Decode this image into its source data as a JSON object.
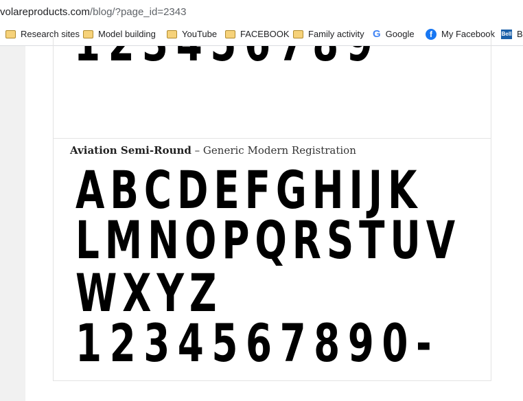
{
  "address_bar": {
    "domain": "volareproducts.com",
    "path": "/blog/?page_id=2343"
  },
  "bookmarks": [
    {
      "label": "Research sites",
      "icon": "folder-icon"
    },
    {
      "label": "Model building",
      "icon": "folder-icon"
    },
    {
      "label": "YouTube",
      "icon": "folder-icon"
    },
    {
      "label": "FACEBOOK",
      "icon": "folder-icon"
    },
    {
      "label": "Family activity",
      "icon": "folder-icon"
    },
    {
      "label": "Google",
      "icon": "google-icon"
    },
    {
      "label": "My Facebook",
      "icon": "facebook-icon"
    },
    {
      "label": "B",
      "icon": "bell-icon"
    }
  ],
  "previous_font": {
    "digits": "123456789"
  },
  "font_sample": {
    "name": "Aviation Semi-Round",
    "separator": " – ",
    "description": "Generic Modern Registration",
    "rows": [
      "ABCDEFGHIJK",
      "LMNOPQRSTUV",
      "WXYZ",
      "1234567890-"
    ]
  }
}
